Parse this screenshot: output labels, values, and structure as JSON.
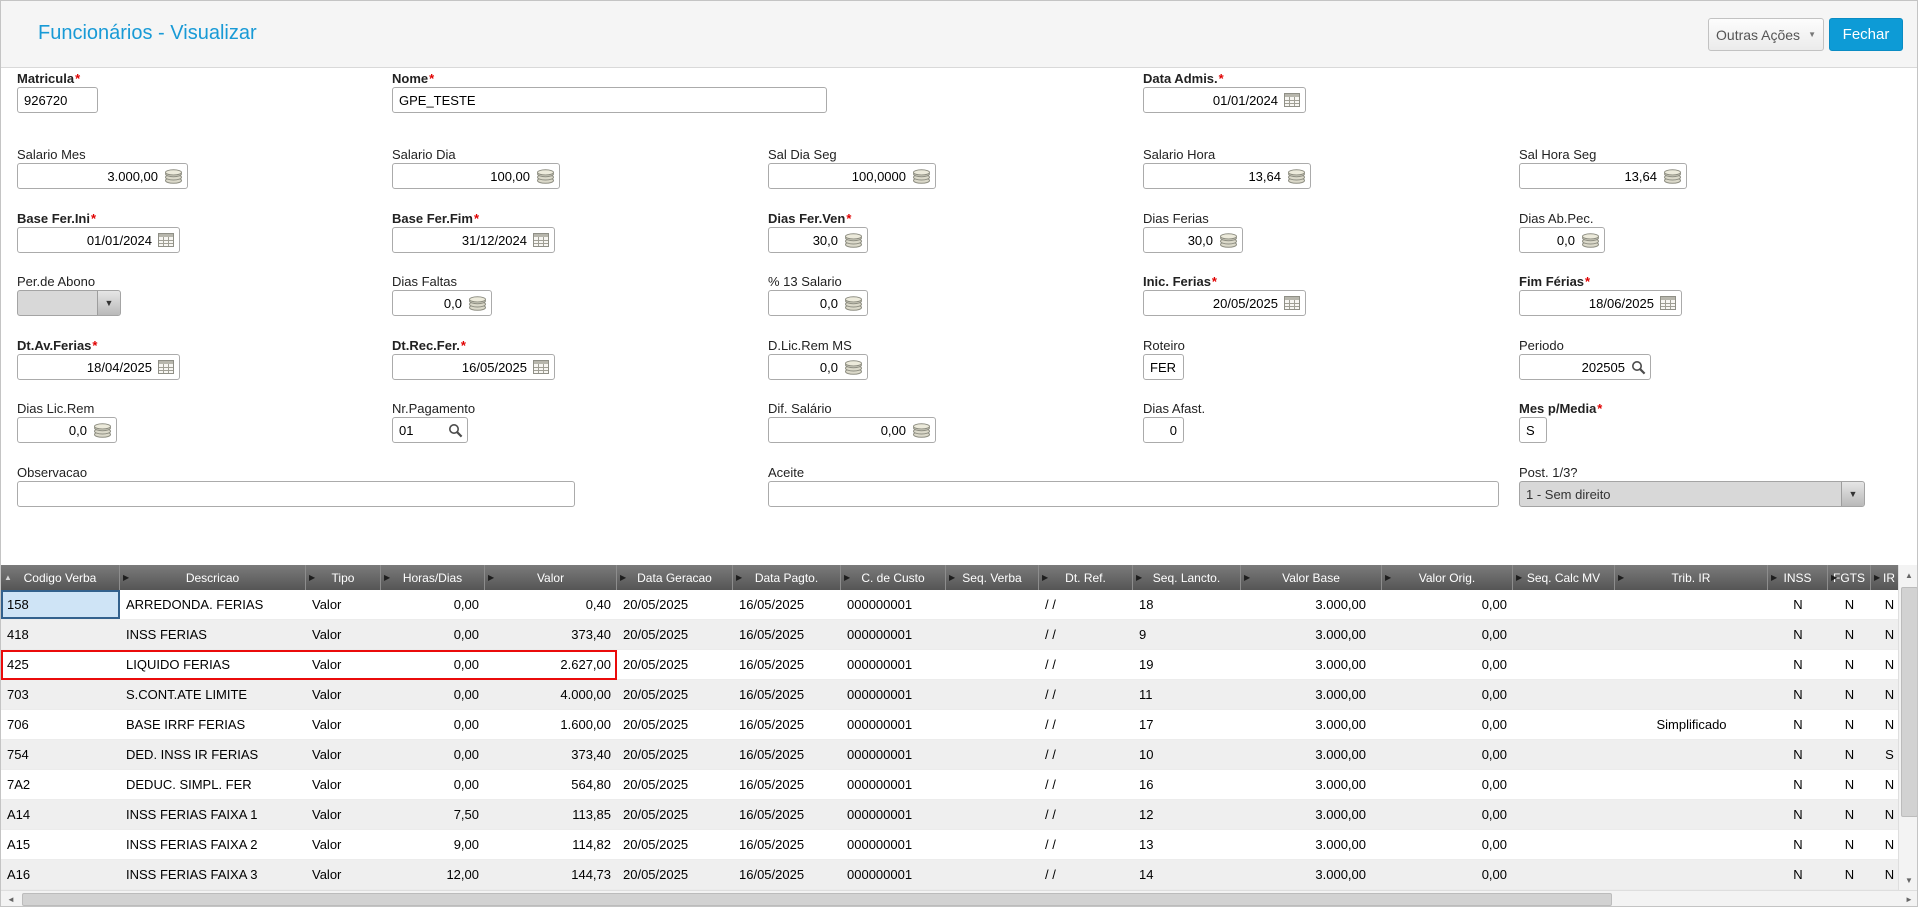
{
  "window": {
    "title": "Funcionários - Visualizar",
    "actions": {
      "other_actions": "Outras Ações",
      "close": "Fechar"
    }
  },
  "ui": {
    "required_marker": "*"
  },
  "icons": {
    "calendar-icon": "calendar",
    "money-icon": "coin-stack",
    "magnifier-icon": "magnifier",
    "chevron-down-icon": "▼",
    "sort-asc-icon": "▲",
    "column-marker-icon": "▶",
    "scroll-up-icon": "▲",
    "scroll-down-icon": "▼",
    "scroll-left-icon": "◄",
    "scroll-right-icon": "►"
  },
  "colors": {
    "accent_blue": "#0d9bd6",
    "title_blue": "#189ad6",
    "highlight_red": "#ea0b0b",
    "grid_header_gray": "#5f5f5f"
  },
  "form": {
    "fields": [
      {
        "id": "matricula",
        "label": "Matricula",
        "required": true,
        "value": "926720",
        "icon": null,
        "align": "left"
      },
      {
        "id": "nome",
        "label": "Nome",
        "required": true,
        "value": "GPE_TESTE",
        "icon": null,
        "align": "left"
      },
      {
        "id": "data-admis",
        "label": "Data Admis.",
        "required": true,
        "value": "01/01/2024",
        "icon": "calendar-icon",
        "align": "right"
      },
      {
        "id": "salario-mes",
        "label": "Salario Mes",
        "required": false,
        "value": "3.000,00",
        "icon": "money-icon",
        "align": "right"
      },
      {
        "id": "salario-dia",
        "label": "Salario Dia",
        "required": false,
        "value": "100,00",
        "icon": "money-icon",
        "align": "right"
      },
      {
        "id": "sal-dia-seg",
        "label": "Sal Dia Seg",
        "required": false,
        "value": "100,0000",
        "icon": "money-icon",
        "align": "right"
      },
      {
        "id": "salario-hora",
        "label": "Salario Hora",
        "required": false,
        "value": "13,64",
        "icon": "money-icon",
        "align": "right"
      },
      {
        "id": "sal-hora-seg",
        "label": "Sal Hora Seg",
        "required": false,
        "value": "13,64",
        "icon": "money-icon",
        "align": "right"
      },
      {
        "id": "base-fer-ini",
        "label": "Base Fer.Ini",
        "required": true,
        "value": "01/01/2024",
        "icon": "calendar-icon",
        "align": "right"
      },
      {
        "id": "base-fer-fim",
        "label": "Base Fer.Fim",
        "required": true,
        "value": "31/12/2024",
        "icon": "calendar-icon",
        "align": "right"
      },
      {
        "id": "dias-fer-ven",
        "label": "Dias Fer.Ven",
        "required": true,
        "value": "30,0",
        "icon": "money-icon",
        "align": "right"
      },
      {
        "id": "dias-ferias",
        "label": "Dias Ferias",
        "required": false,
        "value": "30,0",
        "icon": "money-icon",
        "align": "right"
      },
      {
        "id": "dias-ab-pec",
        "label": "Dias Ab.Pec.",
        "required": false,
        "value": "0,0",
        "icon": "money-icon",
        "align": "right"
      },
      {
        "id": "per-de-abono",
        "label": "Per.de Abono",
        "required": false,
        "value": "",
        "icon": "dropdown-button",
        "align": "left",
        "disabled": true
      },
      {
        "id": "dias-faltas",
        "label": "Dias Faltas",
        "required": false,
        "value": "0,0",
        "icon": "money-icon",
        "align": "right"
      },
      {
        "id": "pct-13-salario",
        "label": "% 13 Salario",
        "required": false,
        "value": "0,0",
        "icon": "money-icon",
        "align": "right"
      },
      {
        "id": "inic-ferias",
        "label": "Inic. Ferias",
        "required": true,
        "value": "20/05/2025",
        "icon": "calendar-icon",
        "align": "right"
      },
      {
        "id": "fim-ferias",
        "label": "Fim Férias",
        "required": true,
        "value": "18/06/2025",
        "icon": "calendar-icon",
        "align": "right"
      },
      {
        "id": "dt-av-ferias",
        "label": "Dt.Av.Ferias",
        "required": true,
        "value": "18/04/2025",
        "icon": "calendar-icon",
        "align": "right"
      },
      {
        "id": "dt-rec-fer",
        "label": "Dt.Rec.Fer.",
        "required": true,
        "value": "16/05/2025",
        "icon": "calendar-icon",
        "align": "right"
      },
      {
        "id": "d-lic-rem-ms",
        "label": "D.Lic.Rem MS",
        "required": false,
        "value": "0,0",
        "icon": "money-icon",
        "align": "right"
      },
      {
        "id": "roteiro",
        "label": "Roteiro",
        "required": false,
        "value": "FER",
        "icon": null,
        "align": "left"
      },
      {
        "id": "periodo",
        "label": "Periodo",
        "required": false,
        "value": "202505",
        "icon": "magnifier-icon",
        "align": "right"
      },
      {
        "id": "dias-lic-rem",
        "label": "Dias Lic.Rem",
        "required": false,
        "value": "0,0",
        "icon": "money-icon",
        "align": "right"
      },
      {
        "id": "nr-pagamento",
        "label": "Nr.Pagamento",
        "required": false,
        "value": "01",
        "icon": "magnifier-icon",
        "align": "left"
      },
      {
        "id": "dif-salario",
        "label": "Dif. Salário",
        "required": false,
        "value": "0,00",
        "icon": "money-icon",
        "align": "right"
      },
      {
        "id": "dias-afast",
        "label": "Dias Afast.",
        "required": false,
        "value": "0",
        "icon": null,
        "align": "right"
      },
      {
        "id": "mes-p-media",
        "label": "Mes p/Media",
        "required": true,
        "value": "S",
        "icon": null,
        "align": "left"
      },
      {
        "id": "observacao",
        "label": "Observacao",
        "required": false,
        "value": "",
        "icon": null,
        "align": "left"
      },
      {
        "id": "aceite",
        "label": "Aceite",
        "required": false,
        "value": "",
        "icon": null,
        "align": "left"
      },
      {
        "id": "post-13",
        "label": "Post. 1/3?",
        "required": false,
        "value": "1 - Sem direito",
        "icon": "dropdown-button",
        "align": "left",
        "disabled": true
      }
    ]
  },
  "grid": {
    "columns": [
      {
        "label": "Codigo Verba",
        "align": "left"
      },
      {
        "label": "Descricao",
        "align": "left"
      },
      {
        "label": "Tipo",
        "align": "left"
      },
      {
        "label": "Horas/Dias",
        "align": "right"
      },
      {
        "label": "Valor",
        "align": "right"
      },
      {
        "label": "Data Geracao",
        "align": "left"
      },
      {
        "label": "Data Pagto.",
        "align": "left"
      },
      {
        "label": "C. de Custo",
        "align": "left"
      },
      {
        "label": "Seq. Verba",
        "align": "left"
      },
      {
        "label": "Dt. Ref.",
        "align": "left"
      },
      {
        "label": "Seq. Lancto.",
        "align": "left"
      },
      {
        "label": "Valor Base",
        "align": "right"
      },
      {
        "label": "Valor Orig.",
        "align": "right"
      },
      {
        "label": "Seq. Calc MV",
        "align": "left"
      },
      {
        "label": "Trib. IR",
        "align": "center"
      },
      {
        "label": "INSS",
        "align": "center"
      },
      {
        "label": "FGTS",
        "align": "center"
      },
      {
        "label": "IR",
        "align": "center"
      }
    ],
    "rows": [
      [
        "158",
        "ARREDONDA. FERIAS",
        "Valor",
        "0,00",
        "0,40",
        "20/05/2025",
        "16/05/2025",
        "000000001",
        "",
        "/ /",
        "18",
        "3.000,00",
        "0,00",
        "",
        "",
        "N",
        "N",
        "N"
      ],
      [
        "418",
        "INSS FERIAS",
        "Valor",
        "0,00",
        "373,40",
        "20/05/2025",
        "16/05/2025",
        "000000001",
        "",
        "/ /",
        "9",
        "3.000,00",
        "0,00",
        "",
        "",
        "N",
        "N",
        "N"
      ],
      [
        "425",
        "LIQUIDO FERIAS",
        "Valor",
        "0,00",
        "2.627,00",
        "20/05/2025",
        "16/05/2025",
        "000000001",
        "",
        "/ /",
        "19",
        "3.000,00",
        "0,00",
        "",
        "",
        "N",
        "N",
        "N"
      ],
      [
        "703",
        "S.CONT.ATE LIMITE",
        "Valor",
        "0,00",
        "4.000,00",
        "20/05/2025",
        "16/05/2025",
        "000000001",
        "",
        "/ /",
        "11",
        "3.000,00",
        "0,00",
        "",
        "",
        "N",
        "N",
        "N"
      ],
      [
        "706",
        "BASE IRRF FERIAS",
        "Valor",
        "0,00",
        "1.600,00",
        "20/05/2025",
        "16/05/2025",
        "000000001",
        "",
        "/ /",
        "17",
        "3.000,00",
        "0,00",
        "",
        "Simplificado",
        "N",
        "N",
        "N"
      ],
      [
        "754",
        "DED. INSS IR FERIAS",
        "Valor",
        "0,00",
        "373,40",
        "20/05/2025",
        "16/05/2025",
        "000000001",
        "",
        "/ /",
        "10",
        "3.000,00",
        "0,00",
        "",
        "",
        "N",
        "N",
        "S"
      ],
      [
        "7A2",
        "DEDUC. SIMPL. FER",
        "Valor",
        "0,00",
        "564,80",
        "20/05/2025",
        "16/05/2025",
        "000000001",
        "",
        "/ /",
        "16",
        "3.000,00",
        "0,00",
        "",
        "",
        "N",
        "N",
        "N"
      ],
      [
        "A14",
        "INSS FERIAS FAIXA 1",
        "Valor",
        "7,50",
        "113,85",
        "20/05/2025",
        "16/05/2025",
        "000000001",
        "",
        "/ /",
        "12",
        "3.000,00",
        "0,00",
        "",
        "",
        "N",
        "N",
        "N"
      ],
      [
        "A15",
        "INSS FERIAS FAIXA 2",
        "Valor",
        "9,00",
        "114,82",
        "20/05/2025",
        "16/05/2025",
        "000000001",
        "",
        "/ /",
        "13",
        "3.000,00",
        "0,00",
        "",
        "",
        "N",
        "N",
        "N"
      ],
      [
        "A16",
        "INSS FERIAS FAIXA 3",
        "Valor",
        "12,00",
        "144,73",
        "20/05/2025",
        "16/05/2025",
        "000000001",
        "",
        "/ /",
        "14",
        "3.000,00",
        "0,00",
        "",
        "",
        "N",
        "N",
        "N"
      ]
    ],
    "selected_cell": {
      "row": 0,
      "col": 0
    },
    "highlight_row_index": 2
  }
}
